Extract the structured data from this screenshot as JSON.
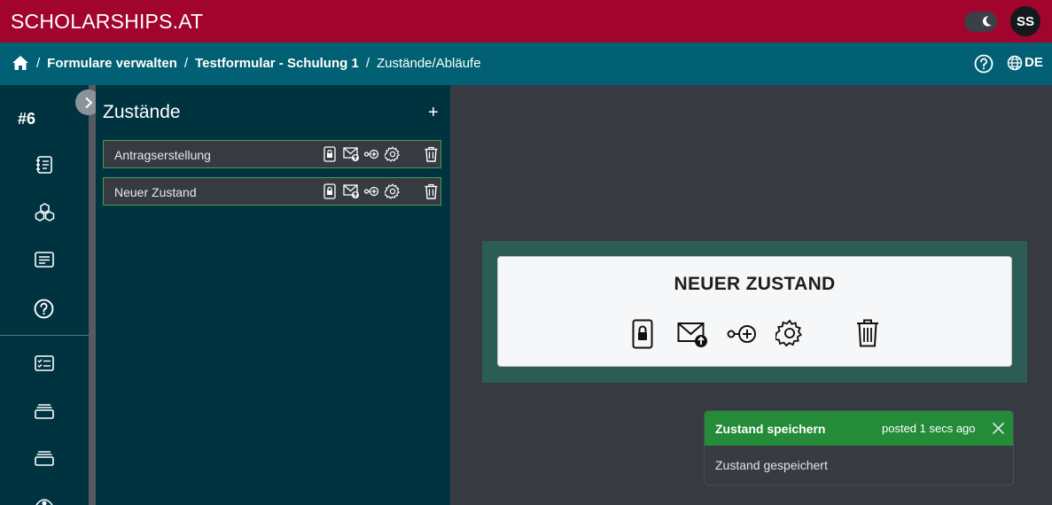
{
  "app": {
    "brand": "SCHOLARSHIPS.AT",
    "avatar_initials": "SS",
    "language": "DE"
  },
  "breadcrumb": {
    "items": [
      "Formulare verwalten",
      "Testformular - Schulung 1"
    ],
    "current": "Zustände/Abläufe",
    "separator": "/"
  },
  "sidebar": {
    "number": "#6",
    "icons": [
      "notebook-icon",
      "cubes-icon",
      "card-text-icon",
      "question-circle-icon",
      "checklist-icon",
      "layers-icon",
      "layers-icon",
      "eye-icon"
    ]
  },
  "states_panel": {
    "title": "Zustände",
    "add_label": "+",
    "items": [
      {
        "label": "Antragserstellung"
      },
      {
        "label": "Neuer Zustand"
      }
    ]
  },
  "selected_state": {
    "title": "NEUER ZUSTAND"
  },
  "toast": {
    "title": "Zustand speichern",
    "time": "posted 1 secs ago",
    "message": "Zustand gespeichert"
  },
  "colors": {
    "topbar": "#a1042c",
    "breadcrumb_bar": "#016073",
    "sidebar": "#003340",
    "success": "#248b38",
    "state_border": "#4d9a51"
  }
}
